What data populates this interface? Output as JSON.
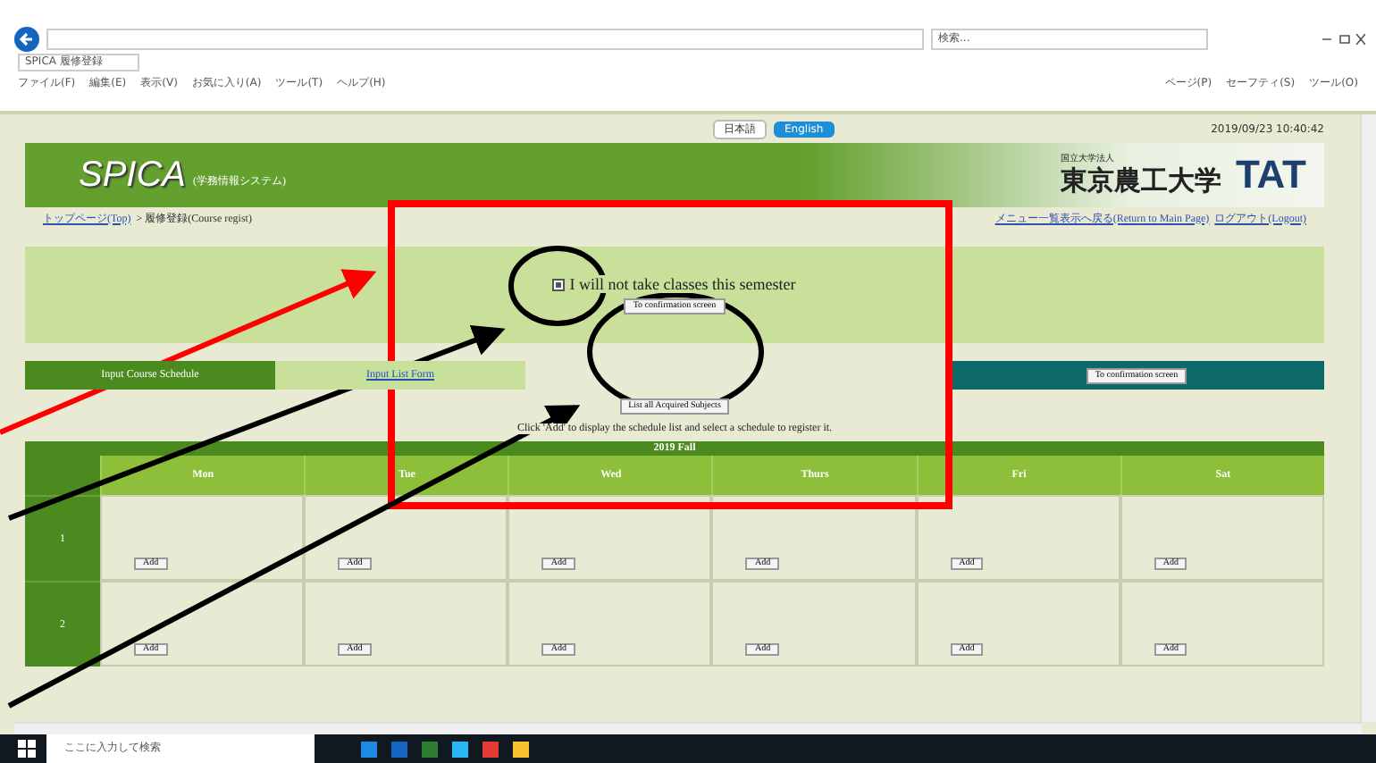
{
  "browser": {
    "tab_title": "SPICA 履修登録",
    "search_placeholder": "検索...",
    "menu": [
      "ファイル(F)",
      "編集(E)",
      "表示(V)",
      "お気に入り(A)",
      "ツール(T)",
      "ヘルプ(H)"
    ],
    "toolbar": [
      "ページ(P)",
      "セーフティ(S)",
      "ツール(O)"
    ]
  },
  "page": {
    "languages": [
      {
        "label": "日本語",
        "selected": false
      },
      {
        "label": "English",
        "selected": true
      }
    ],
    "datetime": "2019/09/23 10:40:42",
    "logo": "SPICA",
    "logo_subtitle": "(学務情報システム)",
    "university_note": "国立大学法人",
    "university_name": "東京農工大学",
    "university_mark": "TAT",
    "breadcrumb": [
      "トップページ(Top)",
      "> 履修登録(Course regist)"
    ],
    "top_links": [
      "メニュー一覧表示へ戻る(Return to Main Page)",
      "ログアウト(Logout)"
    ],
    "opt_out": {
      "label": "I will not take classes this semester",
      "checked": true
    },
    "confirm_button": "To confirmation screen",
    "tabs": [
      {
        "label": "Input Course Schedule",
        "selected": true
      },
      {
        "label": "Input List Form",
        "selected": false
      }
    ],
    "teal_button": "To confirmation screen",
    "list_button": "List all Acquired Subjects",
    "instruction": "Click 'Add' to display the schedule list and select a schedule to register it.",
    "timetable": {
      "term": "2019  Fall",
      "days": [
        "Mon",
        "Tue",
        "Wed",
        "Thurs",
        "Fri",
        "Sat"
      ],
      "periods": [
        {
          "label": "1",
          "cells": [
            "Add",
            "Add",
            "Add",
            "Add",
            "Add",
            "Add"
          ]
        },
        {
          "label": "2",
          "cells": [
            "Add",
            "Add",
            "Add",
            "Add",
            "Add",
            "Add"
          ]
        }
      ]
    }
  },
  "taskbar": {
    "search_placeholder": "ここに入力して検索"
  }
}
